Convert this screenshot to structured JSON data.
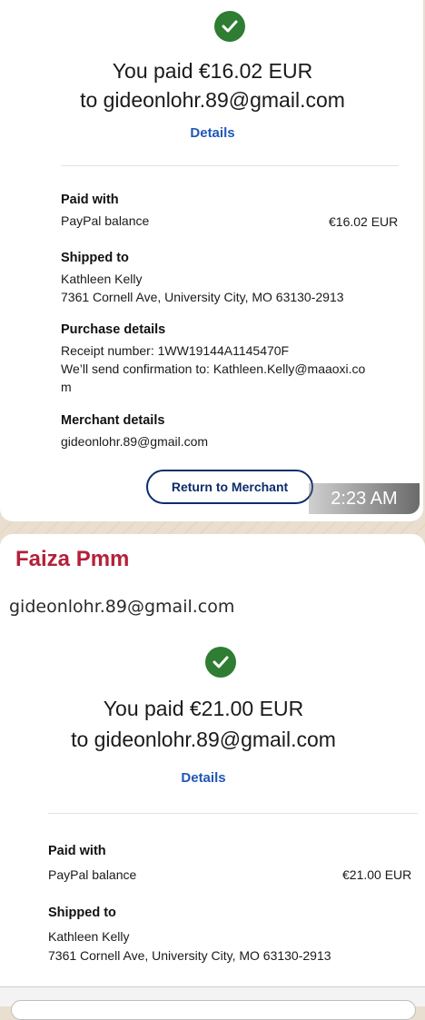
{
  "message1": {
    "headline_line1": "You paid €16.02 EUR",
    "headline_line2": "to gideonlohr.89@gmail.com",
    "details_link": "Details",
    "paid_with_label": "Paid with",
    "paid_with_method": "PayPal balance",
    "paid_with_amount": "€16.02 EUR",
    "shipped_to_label": "Shipped to",
    "ship_name": "Kathleen Kelly",
    "ship_address": "7361 Cornell Ave, University City, MO 63130-2913",
    "purchase_details_label": "Purchase details",
    "receipt_number": "Receipt number: 1WW19144A1145470F",
    "confirmation_line1": "We’ll send confirmation to: Kathleen.Kelly@maaoxi.co",
    "confirmation_line2": "m",
    "merchant_details_label": "Merchant details",
    "merchant_email": "gideonlohr.89@gmail.com",
    "return_button": "Return to Merchant",
    "time": "2:23 AM"
  },
  "message2": {
    "sender": "Faiza Pmm",
    "caption_email": "gideonlohr.89@gmail.com",
    "headline_line1": "You paid €21.00 EUR",
    "headline_line2": "to gideonlohr.89@gmail.com",
    "details_link": "Details",
    "paid_with_label": "Paid with",
    "paid_with_method": "PayPal balance",
    "paid_with_amount": "€21.00 EUR",
    "shipped_to_label": "Shipped to",
    "ship_name": "Kathleen Kelly",
    "ship_address": "7361 Cornell Ave, University City, MO 63130-2913"
  },
  "colors": {
    "success_green": "#2e7d32",
    "link_blue": "#1f57b8",
    "button_navy": "#0c2d6b",
    "sender_red": "#b3213a"
  },
  "icons": [
    "check-circle-icon"
  ]
}
